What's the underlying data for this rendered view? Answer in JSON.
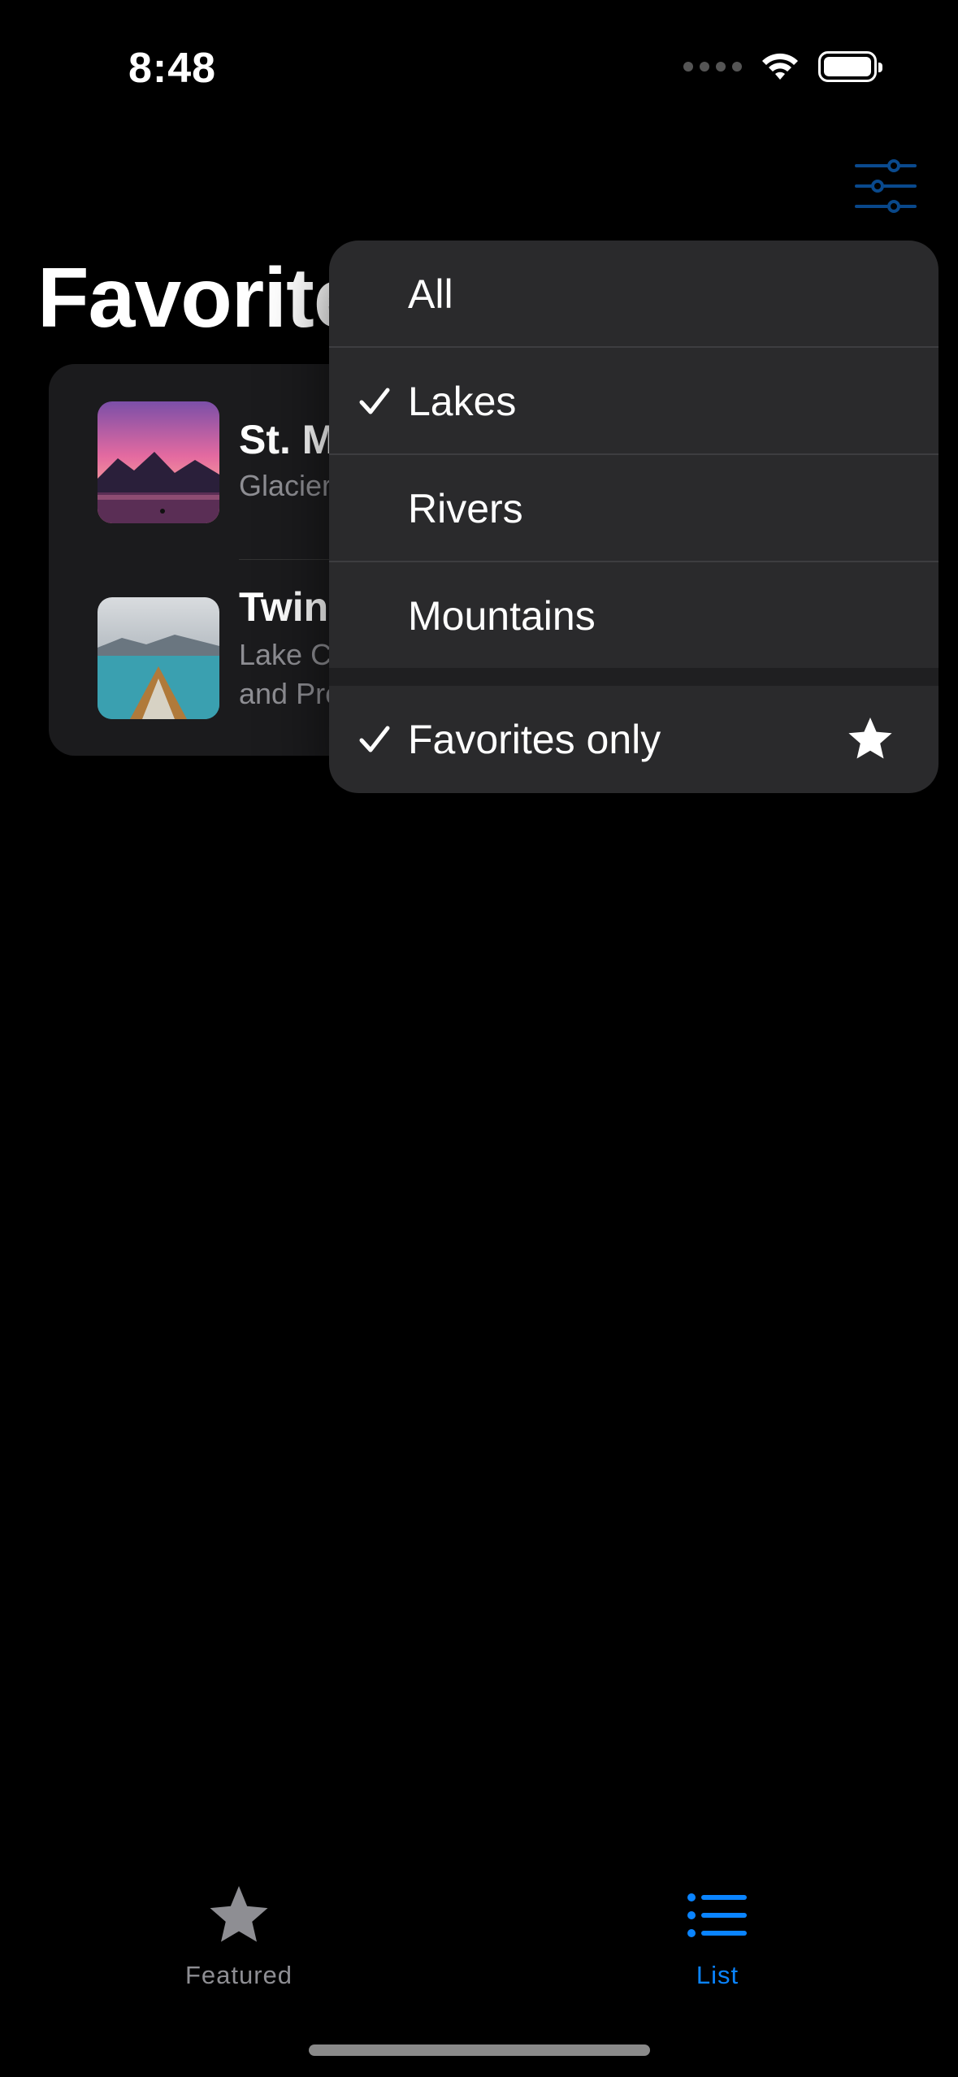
{
  "status_bar": {
    "time": "8:48"
  },
  "page": {
    "title": "Favorites"
  },
  "list": {
    "items": [
      {
        "title": "St. Mary Lake",
        "subtitle": "Glacier National Park"
      },
      {
        "title": "Twin Lake",
        "subtitle_line1": "Lake Clark National Park",
        "subtitle_line2": "and Preserve"
      }
    ]
  },
  "filter_menu": {
    "options": [
      {
        "label": "All",
        "checked": false
      },
      {
        "label": "Lakes",
        "checked": true
      },
      {
        "label": "Rivers",
        "checked": false
      },
      {
        "label": "Mountains",
        "checked": false
      }
    ],
    "favorites_toggle": {
      "label": "Favorites only",
      "checked": true,
      "icon": "star-icon"
    }
  },
  "tab_bar": {
    "tabs": [
      {
        "label": "Featured",
        "icon": "star-icon",
        "selected": false
      },
      {
        "label": "List",
        "icon": "list-icon",
        "selected": true
      }
    ]
  },
  "colors": {
    "accent": "#0a84ff",
    "inactive": "#8e8e93",
    "background": "#000000",
    "menu": "#2a2a2c"
  }
}
